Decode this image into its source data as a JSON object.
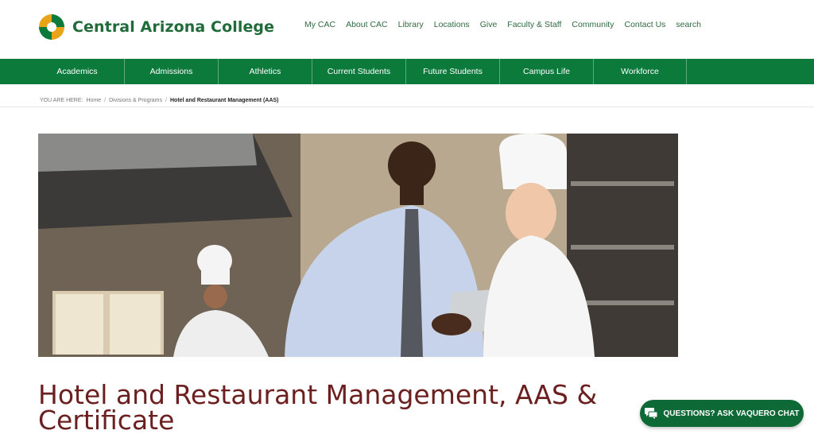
{
  "brand": {
    "name": "Central Arizona College"
  },
  "utility_nav": [
    {
      "label": "My CAC"
    },
    {
      "label": "About CAC"
    },
    {
      "label": "Library"
    },
    {
      "label": "Locations"
    },
    {
      "label": "Give"
    },
    {
      "label": "Faculty & Staff"
    },
    {
      "label": "Community"
    },
    {
      "label": "Contact Us"
    },
    {
      "label": "search"
    }
  ],
  "main_nav": [
    {
      "label": "Academics"
    },
    {
      "label": "Admissions"
    },
    {
      "label": "Athletics"
    },
    {
      "label": "Current Students"
    },
    {
      "label": "Future Students"
    },
    {
      "label": "Campus Life"
    },
    {
      "label": "Workforce"
    }
  ],
  "breadcrumb": {
    "prefix": "YOU ARE HERE:",
    "items": [
      "Home",
      "Divisions & Programs"
    ],
    "current": "Hotel and Restaurant Management (AAS)"
  },
  "page": {
    "title": "Hotel and Restaurant Management, AAS & Certificate"
  },
  "chat": {
    "label": "QUESTIONS? ASK VAQUERO CHAT"
  },
  "colors": {
    "brand_green": "#0b7a3b",
    "title_maroon": "#6b1f1f",
    "logo_gold": "#e8a317"
  }
}
